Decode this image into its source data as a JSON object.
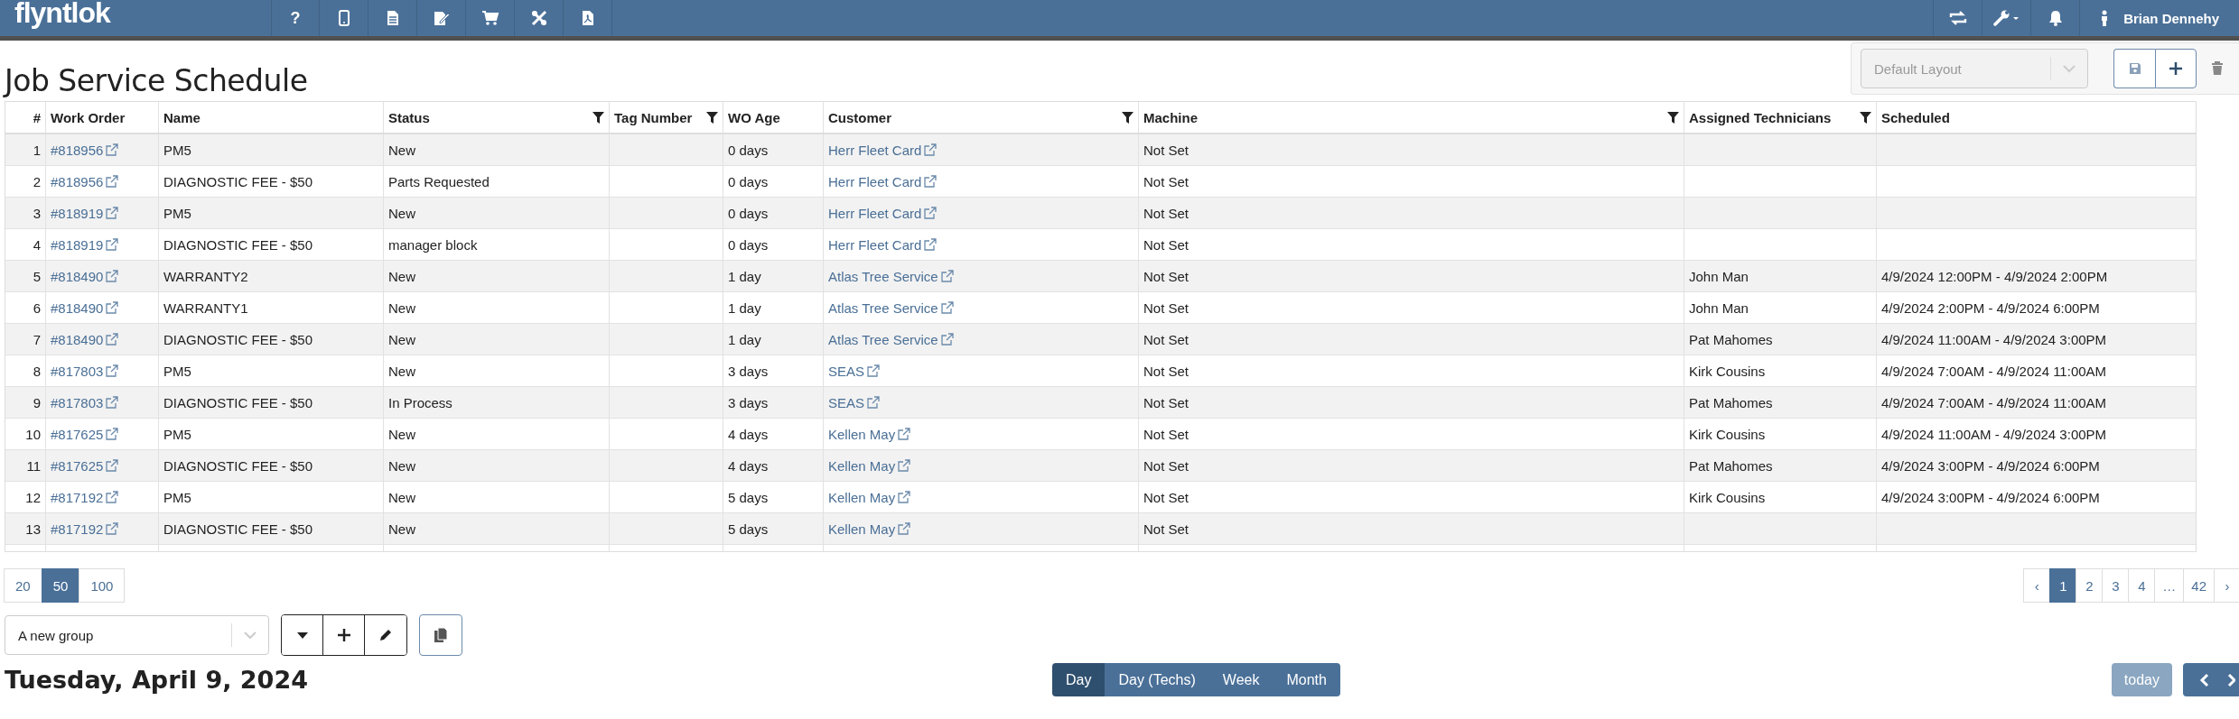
{
  "navbar": {
    "logo": "flyntlok",
    "tools": [
      {
        "kind": "help",
        "label": "?"
      },
      {
        "kind": "phone"
      },
      {
        "kind": "document"
      },
      {
        "kind": "edit"
      },
      {
        "kind": "cart"
      },
      {
        "kind": "tools"
      },
      {
        "kind": "pdf"
      }
    ],
    "right_tools": [
      {
        "kind": "sync"
      },
      {
        "kind": "wrench"
      },
      {
        "kind": "bell"
      }
    ],
    "user": "Brian Dennehy"
  },
  "page_title": "Job Service Schedule",
  "layout_picker": {
    "value": "Default Layout",
    "disabled": true
  },
  "table": {
    "columns": [
      {
        "label": "#",
        "kind": "index",
        "filter": false
      },
      {
        "label": "Work Order",
        "kind": "link",
        "filter": false
      },
      {
        "label": "Name",
        "kind": "text",
        "filter": false
      },
      {
        "label": "Status",
        "kind": "text",
        "filter": true
      },
      {
        "label": "Tag Number",
        "kind": "text",
        "filter": true
      },
      {
        "label": "WO Age",
        "kind": "text",
        "filter": false
      },
      {
        "label": "Customer",
        "kind": "link",
        "filter": true
      },
      {
        "label": "Machine",
        "kind": "text",
        "filter": true
      },
      {
        "label": "Assigned Technicians",
        "kind": "text",
        "filter": true
      },
      {
        "label": "Scheduled",
        "kind": "text",
        "filter": false
      }
    ],
    "rows": [
      {
        "number": "1",
        "work_order": "#818956",
        "name": "PM5",
        "status": "New",
        "wo_age": "0 days",
        "customer": "Herr Fleet Card",
        "machine": "Not Set"
      },
      {
        "number": "2",
        "work_order": "#818956",
        "name": "DIAGNOSTIC FEE - $50",
        "status": "Parts Requested",
        "wo_age": "0 days",
        "customer": "Herr Fleet Card",
        "machine": "Not Set"
      },
      {
        "number": "3",
        "work_order": "#818919",
        "name": "PM5",
        "status": "New",
        "wo_age": "0 days",
        "customer": "Herr Fleet Card",
        "machine": "Not Set"
      },
      {
        "number": "4",
        "work_order": "#818919",
        "name": "DIAGNOSTIC FEE - $50",
        "status": "manager block",
        "wo_age": "0 days",
        "customer": "Herr Fleet Card",
        "machine": "Not Set"
      },
      {
        "number": "5",
        "work_order": "#818490",
        "name": "WARRANTY2",
        "status": "New",
        "wo_age": "1 day",
        "customer": "Atlas Tree Service",
        "machine": "Not Set",
        "technicians": "John Man",
        "scheduled": "4/9/2024 12:00PM - 4/9/2024 2:00PM"
      },
      {
        "number": "6",
        "work_order": "#818490",
        "name": "WARRANTY1",
        "status": "New",
        "wo_age": "1 day",
        "customer": "Atlas Tree Service",
        "machine": "Not Set",
        "technicians": "John Man",
        "scheduled": "4/9/2024 2:00PM - 4/9/2024 6:00PM"
      },
      {
        "number": "7",
        "work_order": "#818490",
        "name": "DIAGNOSTIC FEE - $50",
        "status": "New",
        "wo_age": "1 day",
        "customer": "Atlas Tree Service",
        "machine": "Not Set",
        "technicians": "Pat Mahomes",
        "scheduled": "4/9/2024 11:00AM - 4/9/2024 3:00PM"
      },
      {
        "number": "8",
        "work_order": "#817803",
        "name": "PM5",
        "status": "New",
        "wo_age": "3 days",
        "customer": "SEAS",
        "machine": "Not Set",
        "technicians": "Kirk Cousins",
        "scheduled": "4/9/2024 7:00AM - 4/9/2024 11:00AM"
      },
      {
        "number": "9",
        "work_order": "#817803",
        "name": "DIAGNOSTIC FEE - $50",
        "status": "In Process",
        "wo_age": "3 days",
        "customer": "SEAS",
        "machine": "Not Set",
        "technicians": "Pat Mahomes",
        "scheduled": "4/9/2024 7:00AM - 4/9/2024 11:00AM"
      },
      {
        "number": "10",
        "work_order": "#817625",
        "name": "PM5",
        "status": "New",
        "wo_age": "4 days",
        "customer": "Kellen May",
        "machine": "Not Set",
        "technicians": "Kirk Cousins",
        "scheduled": "4/9/2024 11:00AM - 4/9/2024 3:00PM"
      },
      {
        "number": "11",
        "work_order": "#817625",
        "name": "DIAGNOSTIC FEE - $50",
        "status": "New",
        "wo_age": "4 days",
        "customer": "Kellen May",
        "machine": "Not Set",
        "technicians": "Pat Mahomes",
        "scheduled": "4/9/2024 3:00PM - 4/9/2024 6:00PM"
      },
      {
        "number": "12",
        "work_order": "#817192",
        "name": "PM5",
        "status": "New",
        "wo_age": "5 days",
        "customer": "Kellen May",
        "machine": "Not Set",
        "technicians": "Kirk Cousins",
        "scheduled": "4/9/2024 3:00PM - 4/9/2024 6:00PM"
      },
      {
        "number": "13",
        "work_order": "#817192",
        "name": "DIAGNOSTIC FEE - $50",
        "status": "New",
        "wo_age": "5 days",
        "customer": "Kellen May",
        "machine": "Not Set"
      }
    ]
  },
  "page_sizes": [
    {
      "label": "20",
      "selected": false
    },
    {
      "label": "50",
      "selected": true
    },
    {
      "label": "100",
      "selected": false
    }
  ],
  "pagination": [
    {
      "label": "‹",
      "selected": false
    },
    {
      "label": "1",
      "selected": true
    },
    {
      "label": "2",
      "selected": false
    },
    {
      "label": "3",
      "selected": false
    },
    {
      "label": "4",
      "selected": false
    },
    {
      "label": "…",
      "selected": false
    },
    {
      "label": "42",
      "selected": false
    },
    {
      "label": "›",
      "selected": false
    }
  ],
  "group_picker": {
    "value": "A new group"
  },
  "date_heading": "Tuesday, April 9, 2024",
  "views": [
    {
      "label": "Day",
      "selected": true
    },
    {
      "label": "Day (Techs)",
      "selected": false
    },
    {
      "label": "Week",
      "selected": false
    },
    {
      "label": "Month",
      "selected": false
    }
  ],
  "today_button": {
    "label": "today",
    "disabled": true
  }
}
